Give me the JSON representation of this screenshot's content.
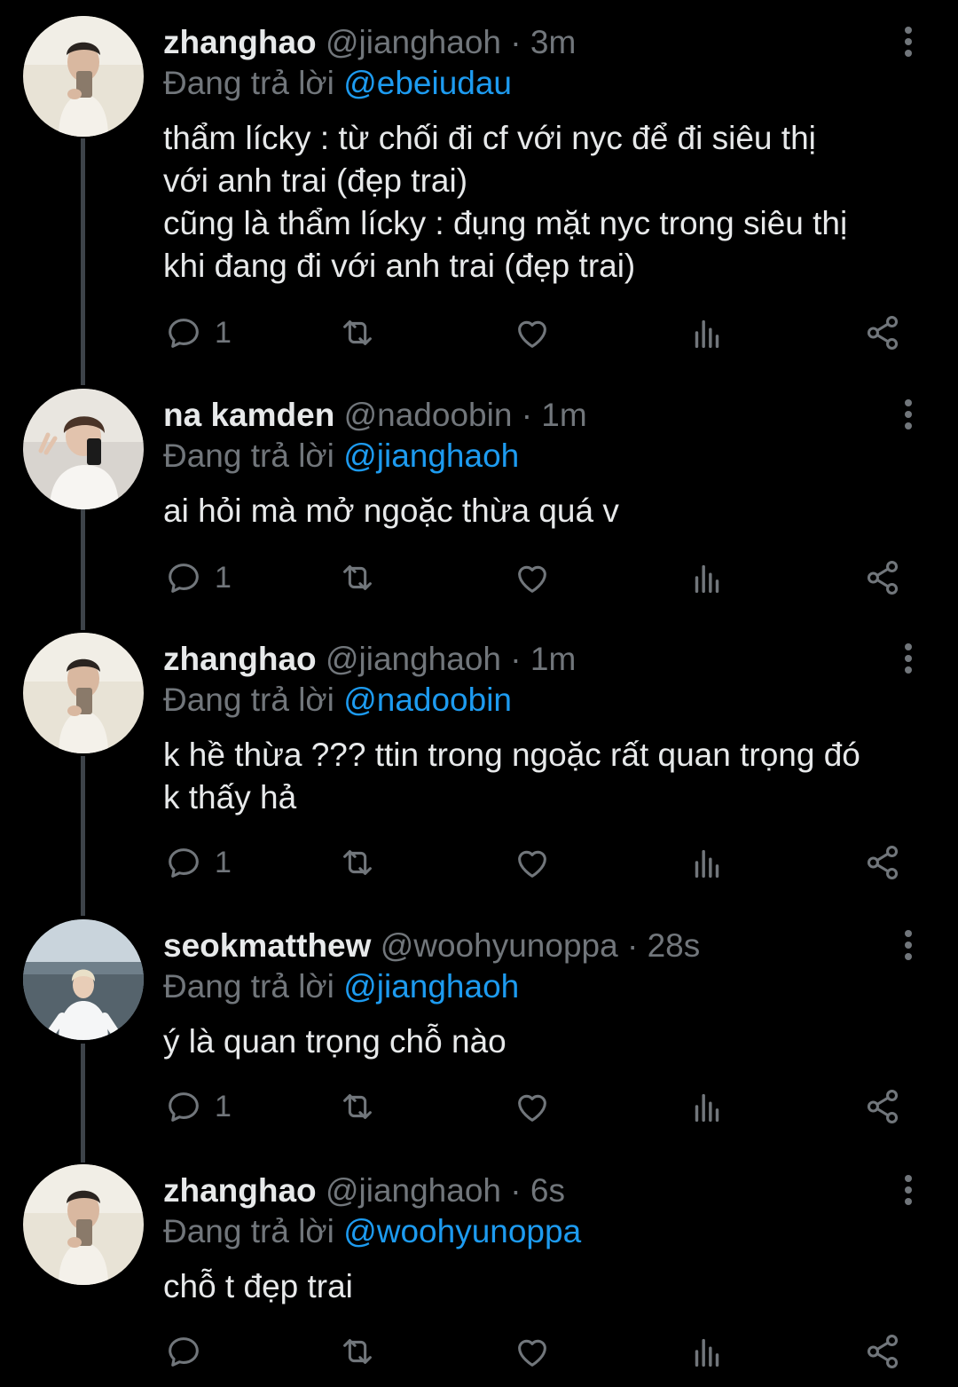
{
  "colors": {
    "background": "#000000",
    "text": "#e7e9ea",
    "muted": "#71767b",
    "link": "#1d9bf0",
    "thread_line": "#3d4349"
  },
  "reply_prefix": "Đang trả lời",
  "icons": [
    "reply-icon",
    "retweet-icon",
    "like-icon",
    "views-icon",
    "share-icon",
    "more-icon"
  ],
  "tweets": [
    {
      "display_name": "zhanghao",
      "handle": "@jianghaoh",
      "time": "· 3m",
      "reply_to": "@ebeiudau",
      "text": "thẩm lícky : từ chối đi cf với nyc để đi siêu thị\nvới anh trai (đẹp trai)\ncũng là thẩm lícky : đụng mặt nyc trong siêu thị\nkhi đang đi với anh trai (đẹp trai)",
      "reply_count": "1"
    },
    {
      "display_name": "na kamden",
      "handle": "@nadoobin",
      "time": "· 1m",
      "reply_to": "@jianghaoh",
      "text": "ai hỏi mà mở ngoặc thừa quá v",
      "reply_count": "1"
    },
    {
      "display_name": "zhanghao",
      "handle": "@jianghaoh",
      "time": "· 1m",
      "reply_to": "@nadoobin",
      "text": "k hề thừa ??? ttin trong ngoặc rất quan trọng đó\nk thấy hả",
      "reply_count": "1"
    },
    {
      "display_name": "seokmatthew",
      "handle": "@woohyunoppa",
      "time": "· 28s",
      "reply_to": "@jianghaoh",
      "text": "ý là quan trọng chỗ nào",
      "reply_count": "1"
    },
    {
      "display_name": "zhanghao",
      "handle": "@jianghaoh",
      "time": "· 6s",
      "reply_to": "@woohyunoppa",
      "text": "chỗ t đẹp trai",
      "reply_count": ""
    }
  ]
}
